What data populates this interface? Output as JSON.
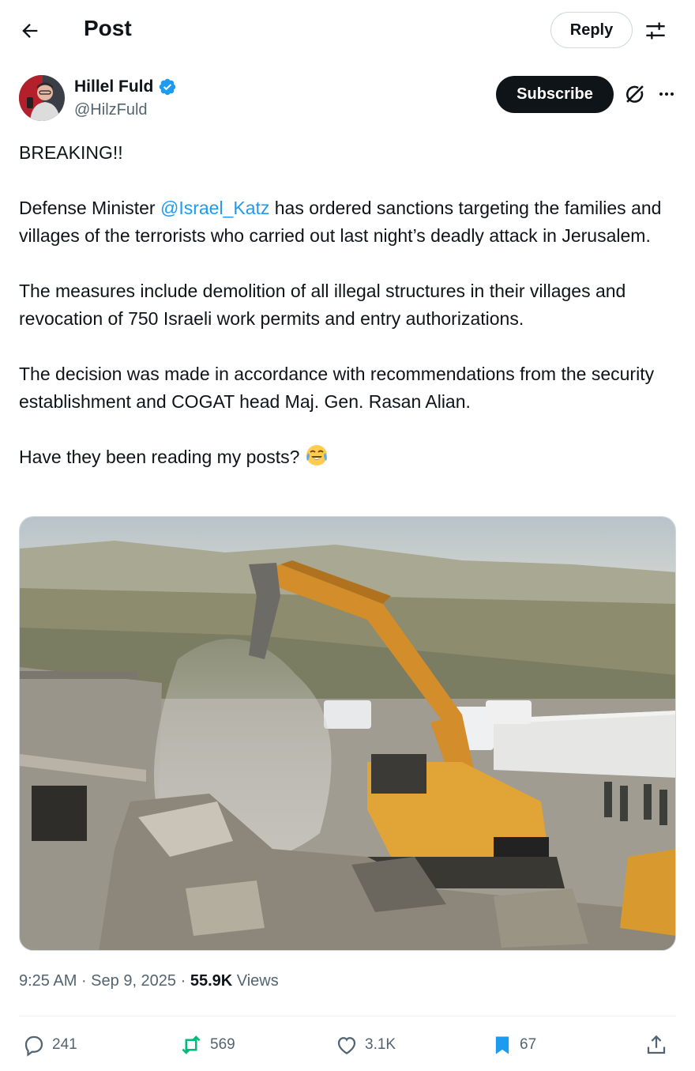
{
  "header": {
    "title": "Post",
    "reply_label": "Reply"
  },
  "author": {
    "name": "Hillel Fuld",
    "handle": "@HilzFuld",
    "verified": true,
    "subscribe_label": "Subscribe"
  },
  "post": {
    "paragraphs": {
      "p1": "BREAKING!!",
      "p2_before": "Defense Minister ",
      "p2_mention": "@Israel_Katz",
      "p2_after": " has ordered sanctions targeting the families and villages of the terrorists who carried out last night’s deadly attack in Jerusalem.",
      "p3": "The measures include demolition of all illegal structures in their villages and revocation of 750 Israeli work permits and entry authorizations.",
      "p4": "The decision was made in accordance with recommendations from the security establishment and COGAT head Maj. Gen. Rasan Alian.",
      "p5": "Have they been reading my posts?"
    },
    "emoji": "face-with-tears-of-joy"
  },
  "meta": {
    "time": "9:25 AM",
    "sep1": " · ",
    "date": "Sep 9, 2025",
    "sep2": " · ",
    "views_count": "55.9K",
    "views_label": " Views"
  },
  "actions": {
    "replies": "241",
    "reposts": "569",
    "likes": "3.1K",
    "bookmarks": "67"
  },
  "colors": {
    "accent": "#1d9bf0",
    "repost": "#00ba7c",
    "text": "#0f1419",
    "secondary": "#536471"
  },
  "icons": [
    "back-arrow-icon",
    "filter-icon",
    "verified-badge-icon",
    "grok-icon",
    "more-icon",
    "reply-icon",
    "repost-icon",
    "like-icon",
    "bookmark-icon",
    "share-icon"
  ]
}
